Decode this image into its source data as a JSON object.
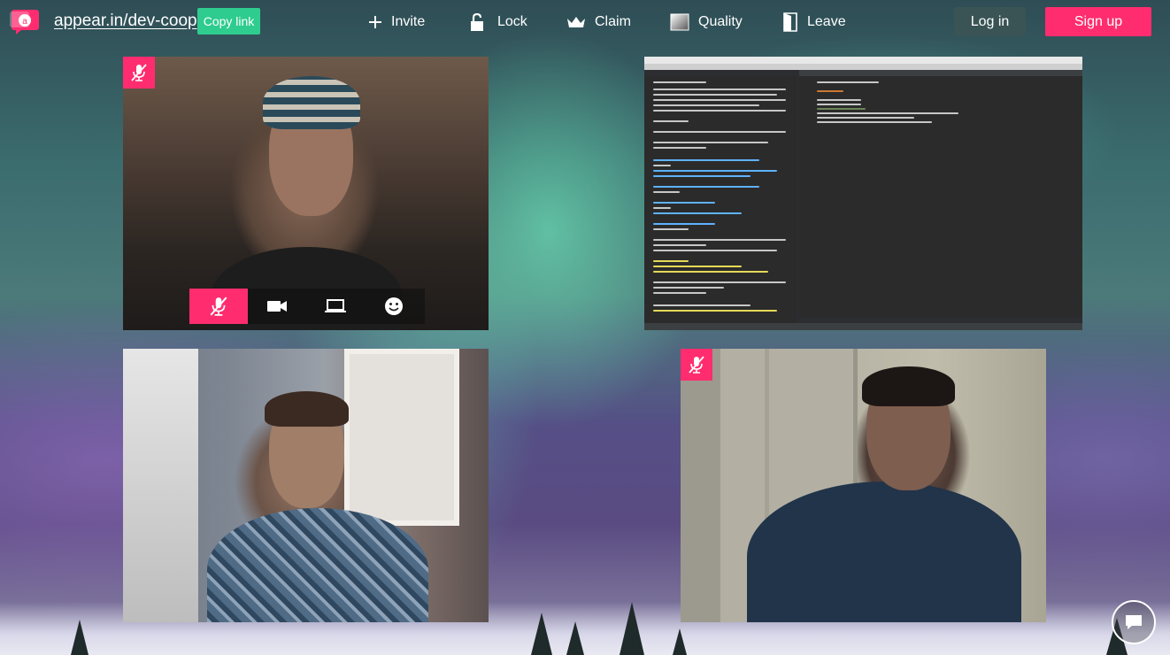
{
  "header": {
    "room_name": "appear.in/dev-coop",
    "copy_link_label": "Copy link",
    "nav": {
      "invite": "Invite",
      "lock": "Lock",
      "claim": "Claim",
      "quality": "Quality",
      "leave": "Leave"
    },
    "login_label": "Log in",
    "signup_label": "Sign up"
  },
  "participants": [
    {
      "id": "participant-1",
      "muted": true,
      "is_self": true
    },
    {
      "id": "screen-share",
      "muted": false
    },
    {
      "id": "participant-3",
      "muted": false
    },
    {
      "id": "participant-4",
      "muted": true
    }
  ],
  "self_controls": [
    "mute-icon",
    "camera-icon",
    "screenshare-icon",
    "emoji-icon"
  ],
  "colors": {
    "accent_pink": "#ff2d6f",
    "copy_green": "#2ecc8f",
    "login_bg": "#3c5555"
  },
  "chat_icon": "chat-bubble-icon"
}
